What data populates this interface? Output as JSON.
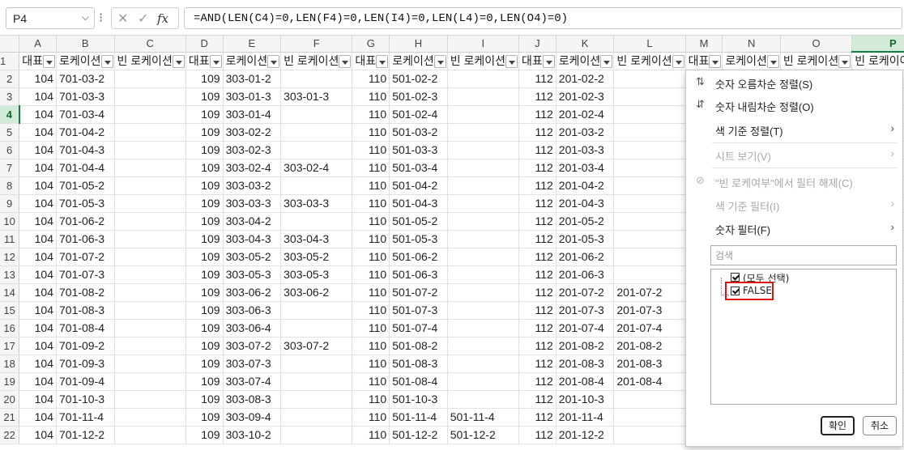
{
  "formula_bar": {
    "name_box": "P4",
    "fx_label": "fx",
    "formula": "=AND(LEN(C4)=0,LEN(F4)=0,LEN(I4)=0,LEN(L4)=0,LEN(O4)=0)"
  },
  "sheet": {
    "columns": [
      "A",
      "B",
      "C",
      "D",
      "E",
      "F",
      "G",
      "H",
      "I",
      "J",
      "K",
      "L",
      "M",
      "N",
      "O",
      "P"
    ],
    "selected_column": "P",
    "selected_row": 4,
    "header_row": [
      "대표",
      "로케이션",
      "빈 로케이션",
      "대표",
      "로케이션",
      "빈 로케이션",
      "대표",
      "로케이션",
      "빈 로케이션",
      "대표",
      "로케이션",
      "빈 로케이션",
      "대표",
      "로케이션",
      "빈 로케이션",
      "빈 로케이여부"
    ],
    "rows": [
      {
        "n": 2,
        "cells": [
          "104",
          "701-03-2",
          "",
          "109",
          "303-01-2",
          "",
          "110",
          "501-02-2",
          "",
          "112",
          "201-02-2",
          "",
          "",
          "",
          "",
          ""
        ]
      },
      {
        "n": 3,
        "cells": [
          "104",
          "701-03-3",
          "",
          "109",
          "303-01-3",
          "303-01-3",
          "110",
          "501-02-3",
          "",
          "112",
          "201-02-3",
          "",
          "",
          "",
          "",
          ""
        ]
      },
      {
        "n": 4,
        "cells": [
          "104",
          "701-03-4",
          "",
          "109",
          "303-01-4",
          "",
          "110",
          "501-02-4",
          "",
          "112",
          "201-02-4",
          "",
          "",
          "",
          "",
          ""
        ]
      },
      {
        "n": 5,
        "cells": [
          "104",
          "701-04-2",
          "",
          "109",
          "303-02-2",
          "",
          "110",
          "501-03-2",
          "",
          "112",
          "201-03-2",
          "",
          "",
          "",
          "",
          ""
        ]
      },
      {
        "n": 6,
        "cells": [
          "104",
          "701-04-3",
          "",
          "109",
          "303-02-3",
          "",
          "110",
          "501-03-3",
          "",
          "112",
          "201-03-3",
          "",
          "",
          "",
          "",
          ""
        ]
      },
      {
        "n": 7,
        "cells": [
          "104",
          "701-04-4",
          "",
          "109",
          "303-02-4",
          "303-02-4",
          "110",
          "501-03-4",
          "",
          "112",
          "201-03-4",
          "",
          "",
          "",
          "",
          ""
        ]
      },
      {
        "n": 8,
        "cells": [
          "104",
          "701-05-2",
          "",
          "109",
          "303-03-2",
          "",
          "110",
          "501-04-2",
          "",
          "112",
          "201-04-2",
          "",
          "",
          "",
          "",
          ""
        ]
      },
      {
        "n": 9,
        "cells": [
          "104",
          "701-05-3",
          "",
          "109",
          "303-03-3",
          "303-03-3",
          "110",
          "501-04-3",
          "",
          "112",
          "201-04-3",
          "",
          "",
          "",
          "",
          ""
        ]
      },
      {
        "n": 10,
        "cells": [
          "104",
          "701-06-2",
          "",
          "109",
          "303-04-2",
          "",
          "110",
          "501-05-2",
          "",
          "112",
          "201-05-2",
          "",
          "",
          "",
          "",
          ""
        ]
      },
      {
        "n": 11,
        "cells": [
          "104",
          "701-06-3",
          "",
          "109",
          "303-04-3",
          "303-04-3",
          "110",
          "501-05-3",
          "",
          "112",
          "201-05-3",
          "",
          "",
          "",
          "",
          ""
        ]
      },
      {
        "n": 12,
        "cells": [
          "104",
          "701-07-2",
          "",
          "109",
          "303-05-2",
          "303-05-2",
          "110",
          "501-06-2",
          "",
          "112",
          "201-06-2",
          "",
          "",
          "",
          "",
          ""
        ]
      },
      {
        "n": 13,
        "cells": [
          "104",
          "701-07-3",
          "",
          "109",
          "303-05-3",
          "303-05-3",
          "110",
          "501-06-3",
          "",
          "112",
          "201-06-3",
          "",
          "",
          "",
          "",
          ""
        ]
      },
      {
        "n": 14,
        "cells": [
          "104",
          "701-08-2",
          "",
          "109",
          "303-06-2",
          "303-06-2",
          "110",
          "501-07-2",
          "",
          "112",
          "201-07-2",
          "201-07-2",
          "",
          "",
          "",
          ""
        ]
      },
      {
        "n": 15,
        "cells": [
          "104",
          "701-08-3",
          "",
          "109",
          "303-06-3",
          "",
          "110",
          "501-07-3",
          "",
          "112",
          "201-07-3",
          "201-07-3",
          "",
          "",
          "",
          ""
        ]
      },
      {
        "n": 16,
        "cells": [
          "104",
          "701-08-4",
          "",
          "109",
          "303-06-4",
          "",
          "110",
          "501-07-4",
          "",
          "112",
          "201-07-4",
          "201-07-4",
          "",
          "",
          "",
          ""
        ]
      },
      {
        "n": 17,
        "cells": [
          "104",
          "701-09-2",
          "",
          "109",
          "303-07-2",
          "303-07-2",
          "110",
          "501-08-2",
          "",
          "112",
          "201-08-2",
          "201-08-2",
          "",
          "",
          "",
          ""
        ]
      },
      {
        "n": 18,
        "cells": [
          "104",
          "701-09-3",
          "",
          "109",
          "303-07-3",
          "",
          "110",
          "501-08-3",
          "",
          "112",
          "201-08-3",
          "201-08-3",
          "",
          "",
          "",
          ""
        ]
      },
      {
        "n": 19,
        "cells": [
          "104",
          "701-09-4",
          "",
          "109",
          "303-07-4",
          "",
          "110",
          "501-08-4",
          "",
          "112",
          "201-08-4",
          "201-08-4",
          "",
          "",
          "",
          ""
        ]
      },
      {
        "n": 20,
        "cells": [
          "104",
          "701-10-3",
          "",
          "109",
          "303-08-3",
          "",
          "110",
          "501-10-3",
          "",
          "112",
          "201-10-3",
          "",
          "",
          "",
          "",
          ""
        ]
      },
      {
        "n": 21,
        "cells": [
          "104",
          "701-11-4",
          "",
          "109",
          "303-09-4",
          "",
          "110",
          "501-11-4",
          "501-11-4",
          "112",
          "201-11-4",
          "",
          "",
          "",
          "",
          ""
        ]
      },
      {
        "n": 22,
        "cells": [
          "104",
          "701-12-2",
          "",
          "109",
          "303-10-2",
          "",
          "110",
          "501-12-2",
          "501-12-2",
          "112",
          "201-12-2",
          "",
          "",
          "",
          "",
          ""
        ]
      }
    ]
  },
  "filter_menu": {
    "sort_asc": "숫자 오름차순 정렬(S)",
    "sort_desc": "숫자 내림차순 정렬(O)",
    "sort_by_color": "색 기준 정렬(T)",
    "sheet_view": "시트 보기(V)",
    "clear_filter": "\"빈 로케여부\"에서 필터 해제(C)",
    "filter_by_color": "색 기준 필터(I)",
    "number_filters": "숫자 필터(F)",
    "search_placeholder": "검색",
    "list_items": [
      {
        "label": "(모두 선택)",
        "checked": true
      },
      {
        "label": "FALSE",
        "checked": true
      }
    ],
    "ok_button": "확인",
    "cancel_button": "취소",
    "highlight_color": "#e11111"
  }
}
